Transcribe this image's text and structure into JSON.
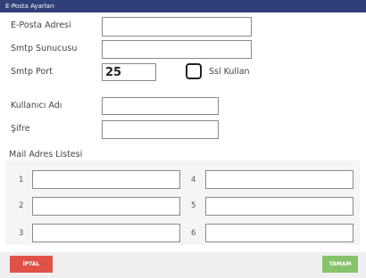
{
  "window": {
    "title": "E-Posta Ayarları"
  },
  "form": {
    "email_label": "E-Posta Adresi",
    "email_value": "",
    "smtp_server_label": "Smtp Sunucusu",
    "smtp_server_value": "",
    "smtp_port_label": "Smtp Port",
    "smtp_port_value": "25",
    "ssl_label": "Ssl Kullan",
    "ssl_checked": false,
    "username_label": "Kullanıcı Adı",
    "username_value": "",
    "password_label": "Şifre",
    "password_value": ""
  },
  "mail_list": {
    "title": "Mail Adres Listesi",
    "items": [
      {
        "number": "1",
        "value": ""
      },
      {
        "number": "2",
        "value": ""
      },
      {
        "number": "3",
        "value": ""
      },
      {
        "number": "4",
        "value": ""
      },
      {
        "number": "5",
        "value": ""
      },
      {
        "number": "6",
        "value": ""
      }
    ]
  },
  "footer": {
    "cancel_label": "İPTAL",
    "ok_label": "TAMAM"
  },
  "colors": {
    "titlebar": "#2f3f78",
    "cancel": "#e05248",
    "ok": "#86c36a"
  }
}
